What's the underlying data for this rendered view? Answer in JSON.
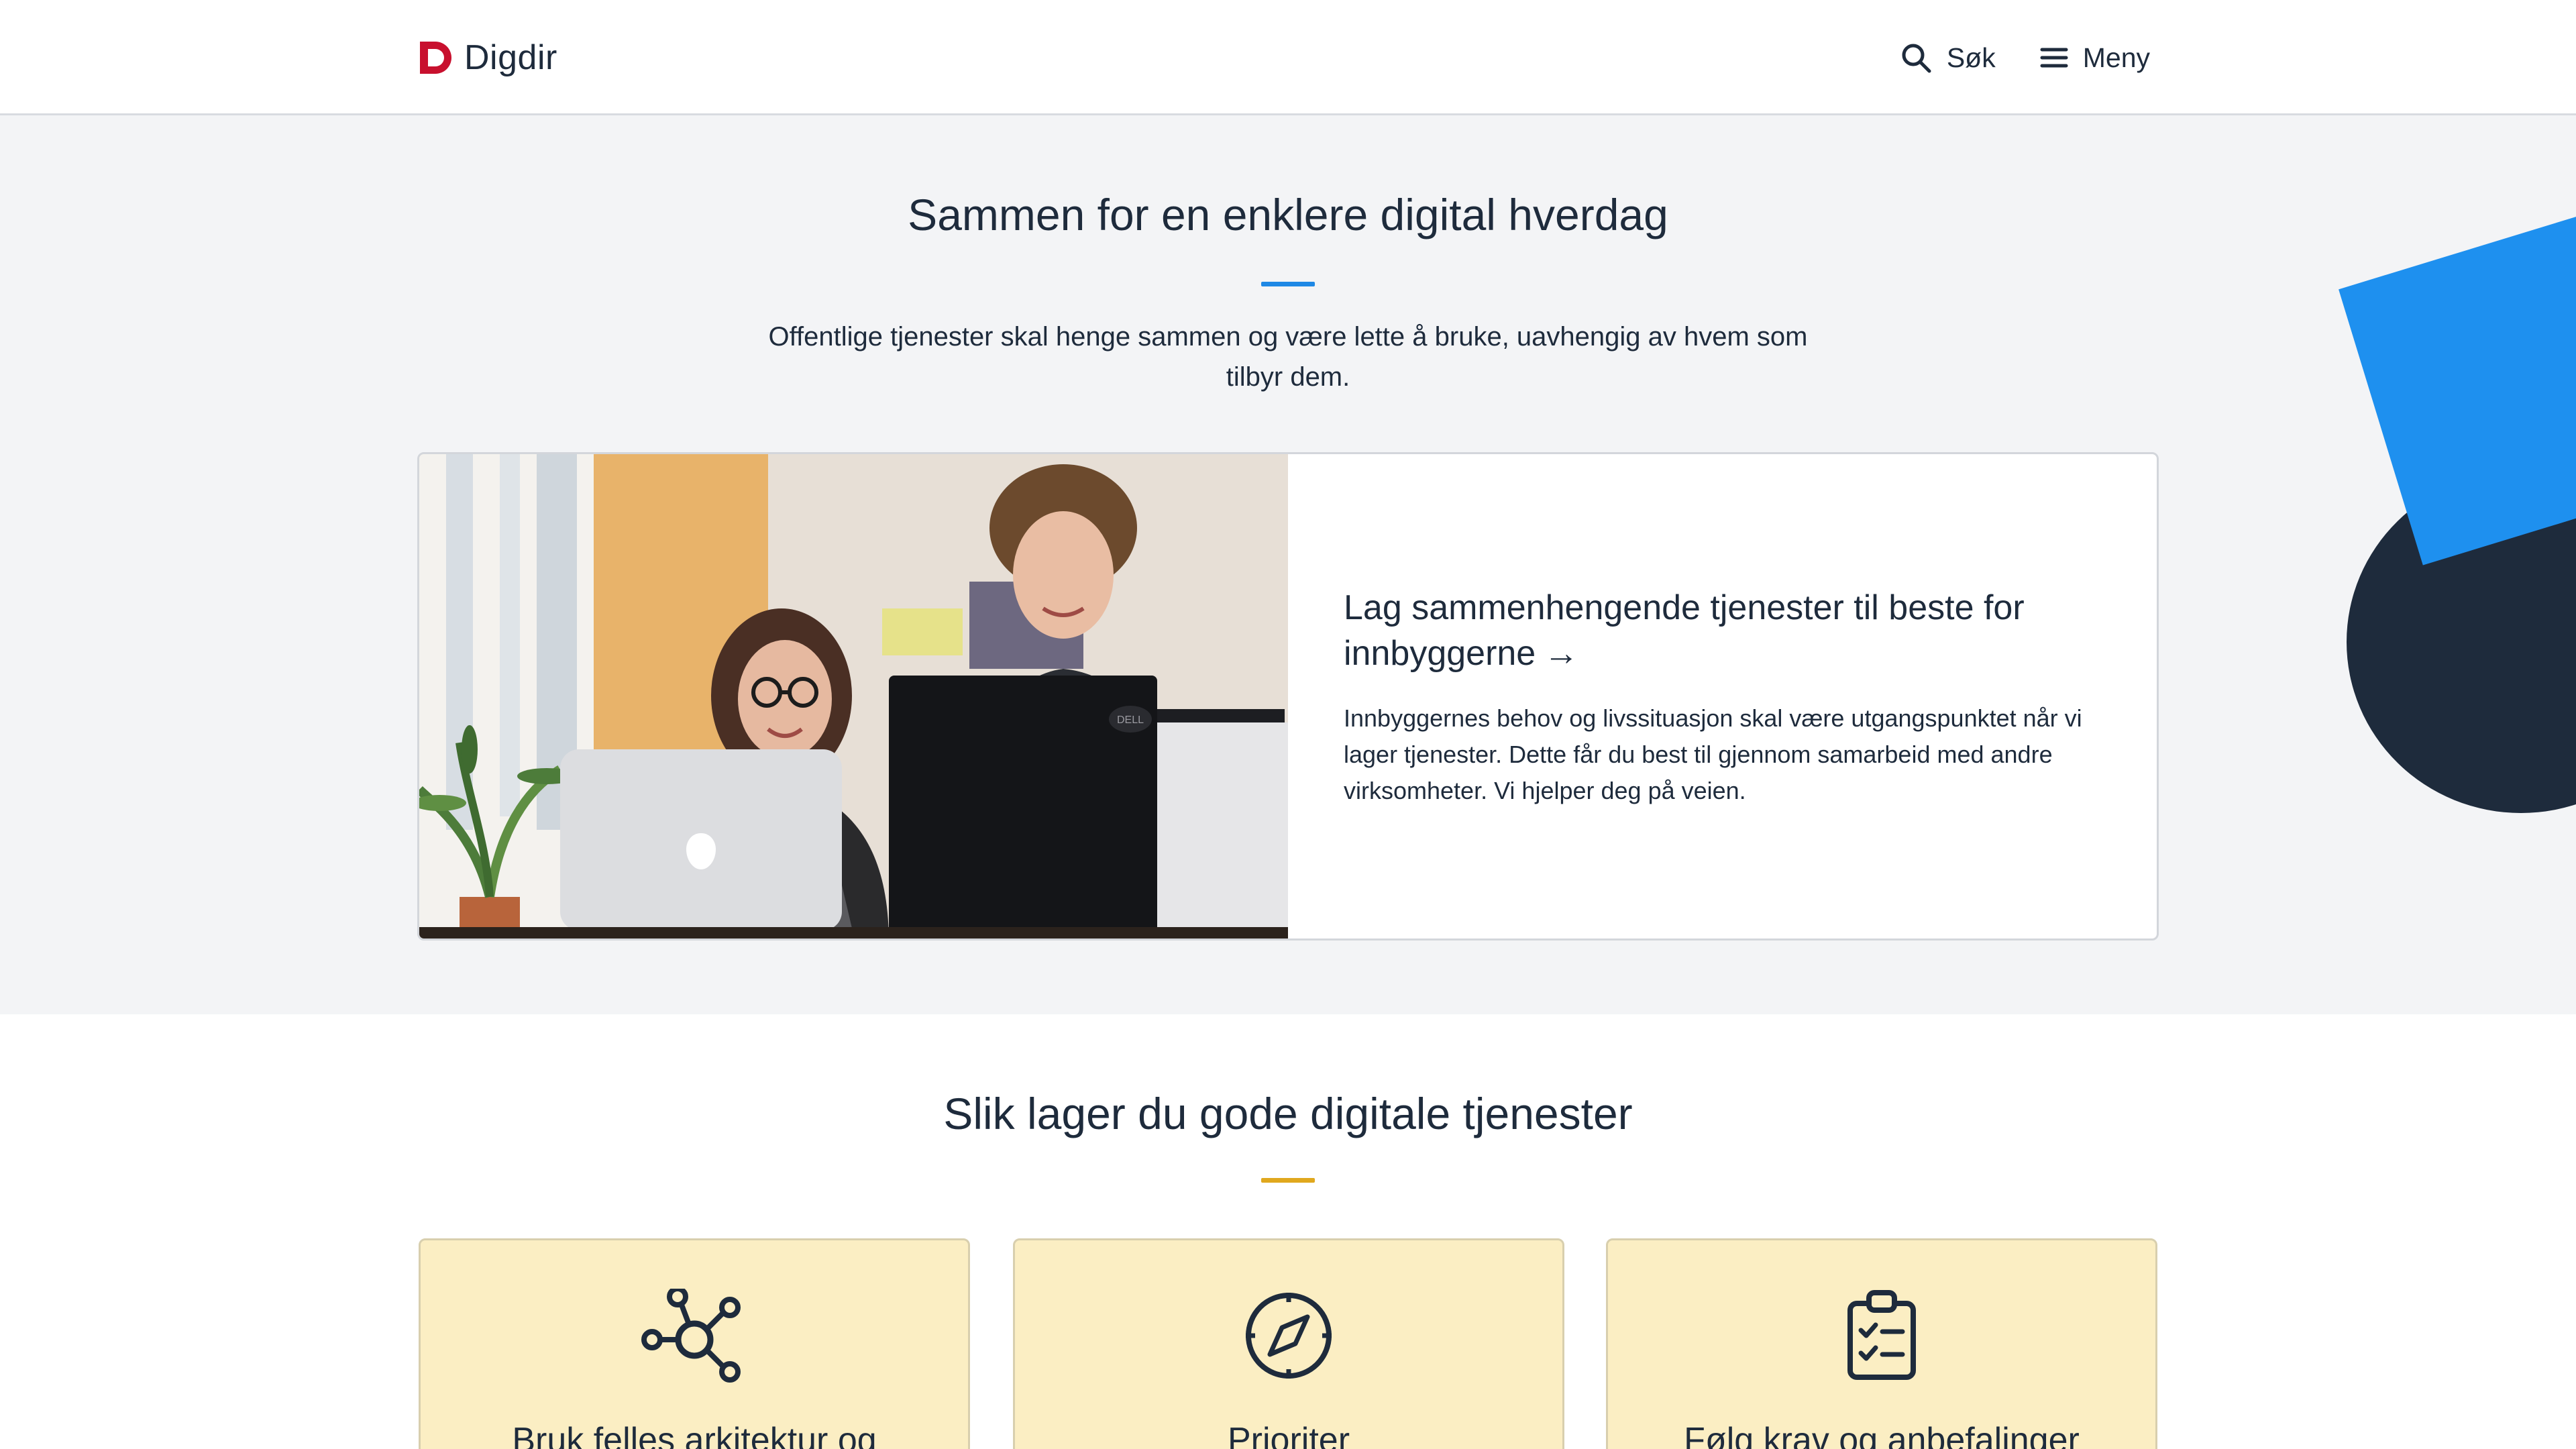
{
  "header": {
    "logo_text": "Digdir",
    "search_label": "Søk",
    "menu_label": "Meny"
  },
  "hero": {
    "title": "Sammen for en enklere digital hverdag",
    "lead": "Offentlige tjenester skal henge sammen og være lette å bruke, uavhengig av hvem som tilbyr dem.",
    "feature": {
      "title": "Lag sammenhengende tjenester til beste for innbyggerne",
      "arrow": "→",
      "text": "Innbyggernes behov og livssituasjon skal være utgangspunktet når vi lager tjenester. Dette får du best til gjennom samarbeid med andre virksomheter. Vi hjelper deg på veien.",
      "laptop_logo": "",
      "monitor_brand": "DELL"
    }
  },
  "section_two": {
    "title": "Slik lager du gode digitale tjenester",
    "cards": [
      {
        "label": "Bruk felles arkitektur og",
        "icon": "network-icon"
      },
      {
        "label": "Prioriter",
        "icon": "compass-icon"
      },
      {
        "label": "Følg krav og anbefalinger",
        "icon": "clipboard-check-icon"
      }
    ]
  },
  "colors": {
    "brand_red": "#c8102e",
    "text_dark": "#1e2b3c",
    "hero_accent_blue": "#1e88e5",
    "section_accent_yellow": "#e0a81e",
    "card_yellow": "#fbeec3",
    "hero_bg": "#f3f4f6",
    "deco_blue": "#1e90ef"
  }
}
